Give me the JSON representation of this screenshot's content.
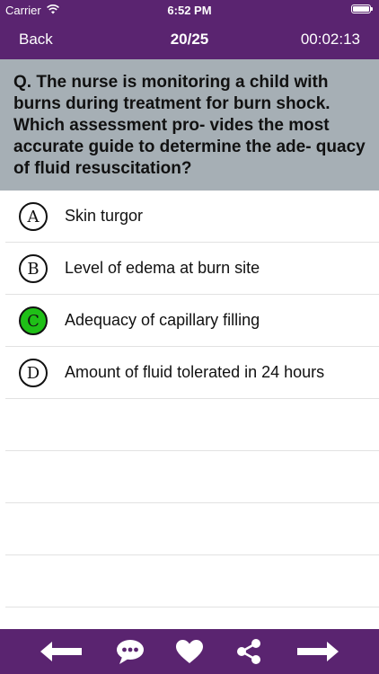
{
  "status_bar": {
    "carrier": "Carrier",
    "time": "6:52 PM"
  },
  "nav": {
    "back_label": "Back",
    "counter": "20/25",
    "timer": "00:02:13"
  },
  "question": {
    "text": "Q. The nurse is monitoring a child with burns during treatment for burn shock. Which assessment pro- vides the most accurate guide to determine the ade- quacy of fluid resuscitation?"
  },
  "options": [
    {
      "letter": "A",
      "text": "Skin turgor",
      "state": "default"
    },
    {
      "letter": "B",
      "text": "Level of edema at burn site",
      "state": "default"
    },
    {
      "letter": "C",
      "text": "Adequacy of capillary filling",
      "state": "correct"
    },
    {
      "letter": "D",
      "text": "Amount of fluid tolerated in 24 hours",
      "state": "default"
    }
  ],
  "toolbar": {
    "icons": [
      "arrow-left-icon",
      "chat-bubble-icon",
      "heart-icon",
      "share-icon",
      "arrow-right-icon"
    ]
  },
  "colors": {
    "bar": "#5a2470",
    "question_bg": "#a6afb5",
    "correct": "#1fc017"
  }
}
